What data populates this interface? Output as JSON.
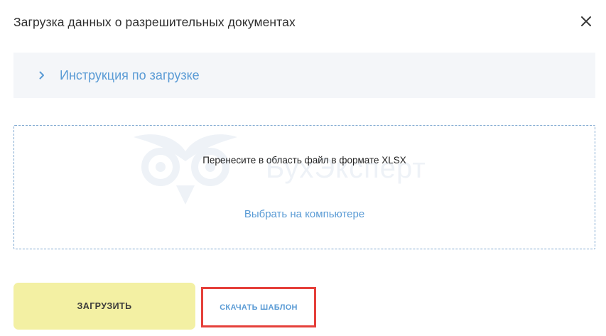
{
  "dialog": {
    "title": "Загрузка данных о разрешительных документах",
    "close_icon": "close-icon"
  },
  "accordion": {
    "label": "Инструкция по загрузке",
    "icon": "chevron-right-icon",
    "accent": "#5a9bd5"
  },
  "dropzone": {
    "hint": "Перенесите в область файл в формате XLSX",
    "link": "Выбрать на компьютере",
    "watermark_text": "БухЭксперт"
  },
  "actions": {
    "upload_label": "ЗАГРУЗИТЬ",
    "upload_color": "#f3f0a3",
    "template_label": "СКАЧАТЬ ШАБЛОН",
    "highlight_color": "#e5403a"
  }
}
